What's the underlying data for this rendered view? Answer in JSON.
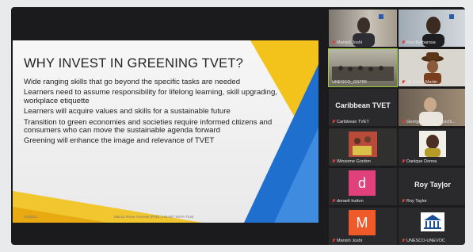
{
  "slide": {
    "title": "WHY INVEST IN GREENING TVET?",
    "bullets": [
      "Wide ranging skills that go beyond the specific tasks are needed",
      "Learners need to assume responsibility for lifelong learning, skill upgrading, workplace etiquette",
      "Learners will acquire values and skills for a sustainable future",
      "Transition to green economies and societies require informed citizens and consumers who can move the sustainable agenda forward",
      "Greening will enhance the image and relevance of TVET"
    ],
    "footer_date": "04/2021",
    "footer_author": "Marcia Rowe-Amonde (PhD) | HEART NSTA Trust"
  },
  "participants": {
    "tiles": [
      {
        "name": "Manish Joshi"
      },
      {
        "name": "Ken Barbarosa"
      },
      {
        "name": "UNESCO_GS700"
      },
      {
        "name": "Dr Junior Martin"
      },
      {
        "name": "Caribbean TVET",
        "big": "Caribbean TVET"
      },
      {
        "name": "George T. - Dorf Boschi..."
      },
      {
        "name": "Winsome Gordon"
      },
      {
        "name": "Danique Donna"
      },
      {
        "name": "doraelt hutton",
        "avatar": "d"
      },
      {
        "name": "Roy Taylor",
        "big": "Roy Tay|or"
      },
      {
        "name": "Manish Joshi",
        "avatar": "M"
      },
      {
        "name": "UNESCO-UNEVOC"
      }
    ]
  },
  "colors": {
    "accent_yellow": "#f3c21b",
    "accent_blue": "#1f6fcf",
    "active_speaker": "#9ccb3c",
    "avatar_pink": "#e1417a",
    "avatar_orange": "#ef5a2b"
  }
}
